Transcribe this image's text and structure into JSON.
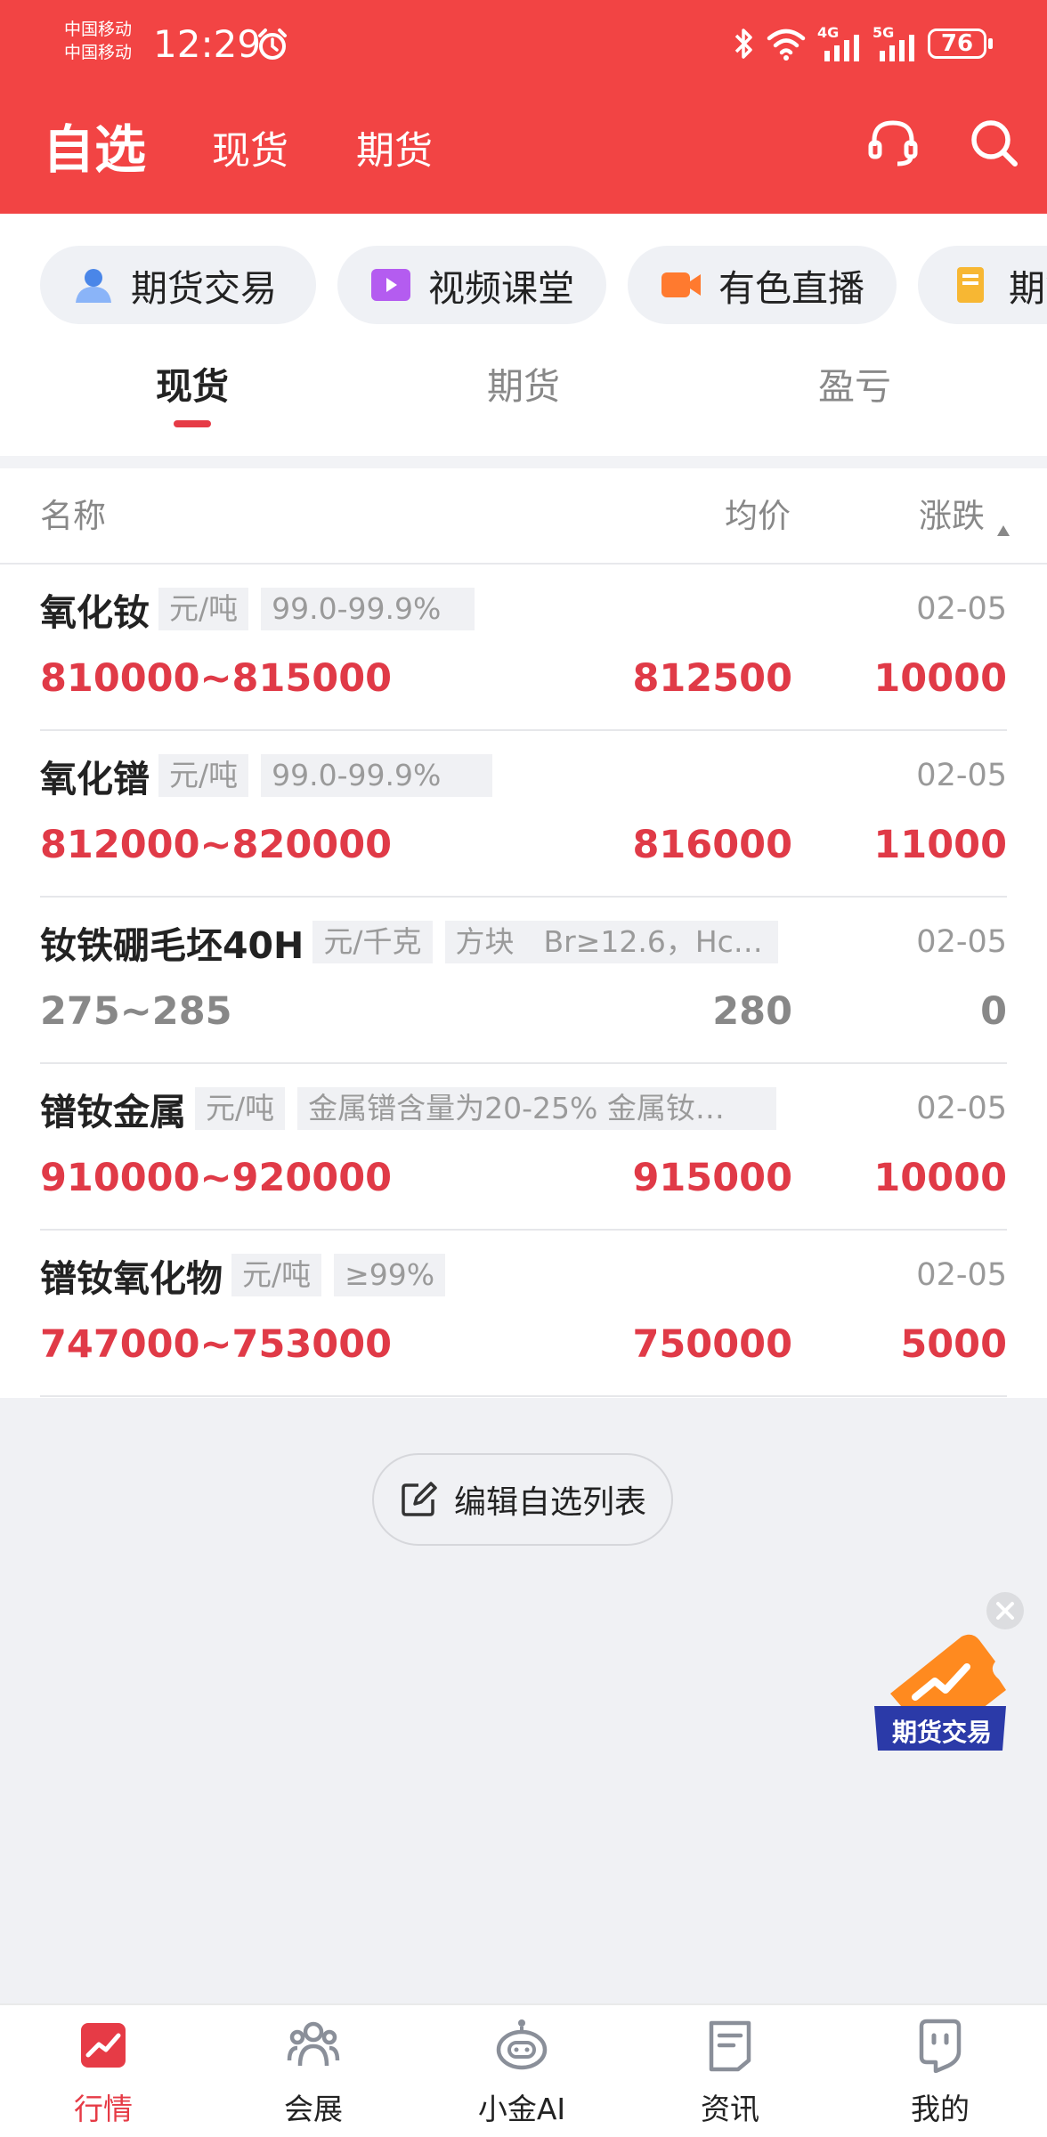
{
  "status_bar": {
    "carrier_1": "中国移动",
    "carrier_2": "中国移动",
    "time": "12:29",
    "net_4g": "4G",
    "net_5g": "5G",
    "battery": "76"
  },
  "top_nav": {
    "title": "自选",
    "tabs": [
      {
        "label": "现货"
      },
      {
        "label": "期货"
      }
    ],
    "icons": [
      "headset-icon",
      "search-icon"
    ]
  },
  "shortcuts": [
    {
      "label": "期货交易",
      "icon": "user-icon"
    },
    {
      "label": "视频课堂",
      "icon": "video-icon"
    },
    {
      "label": "有色直播",
      "icon": "camera-icon"
    },
    {
      "label": "期货",
      "icon": "document-icon"
    }
  ],
  "sub_tabs": [
    {
      "label": "现货",
      "active": true
    },
    {
      "label": "期货",
      "active": false
    },
    {
      "label": "盈亏",
      "active": false
    }
  ],
  "table": {
    "headers": {
      "name": "名称",
      "avg": "均价",
      "change": "涨跌"
    },
    "rows": [
      {
        "name": "氧化钕",
        "unit": "元/吨",
        "spec": "99.0-99.9%",
        "date": "02-05",
        "range": "810000~815000",
        "avg": "812500",
        "change": "10000",
        "trend": "up"
      },
      {
        "name": "氧化镨",
        "unit": "元/吨",
        "spec": "99.0-99.9%",
        "date": "02-05",
        "range": "812000~820000",
        "avg": "816000",
        "change": "11000",
        "trend": "up"
      },
      {
        "name": "钕铁硼毛坯40H",
        "unit": "元/千克",
        "spec": "方块　Br≥12.6，Hc…",
        "date": "02-05",
        "range": "275~285",
        "avg": "280",
        "change": "0",
        "trend": "flat"
      },
      {
        "name": "镨钕金属",
        "unit": "元/吨",
        "spec": "金属镨含量为20-25% 金属钕…",
        "date": "02-05",
        "range": "910000~920000",
        "avg": "915000",
        "change": "10000",
        "trend": "up"
      },
      {
        "name": "镨钕氧化物",
        "unit": "元/吨",
        "spec": "≥99%",
        "date": "02-05",
        "range": "747000~753000",
        "avg": "750000",
        "change": "5000",
        "trend": "up"
      }
    ]
  },
  "edit_button": {
    "label": "编辑自选列表"
  },
  "promo": {
    "label": "期货交易"
  },
  "bottom_nav": [
    {
      "label": "行情",
      "icon": "chart-icon",
      "active": true
    },
    {
      "label": "会展",
      "icon": "people-icon",
      "active": false
    },
    {
      "label": "小金AI",
      "icon": "robot-icon",
      "active": false
    },
    {
      "label": "资讯",
      "icon": "news-icon",
      "active": false
    },
    {
      "label": "我的",
      "icon": "profile-icon",
      "active": false
    }
  ],
  "colors": {
    "brand_red": "#f24444",
    "up_red": "#e03a47",
    "flat_gray": "#888888"
  }
}
